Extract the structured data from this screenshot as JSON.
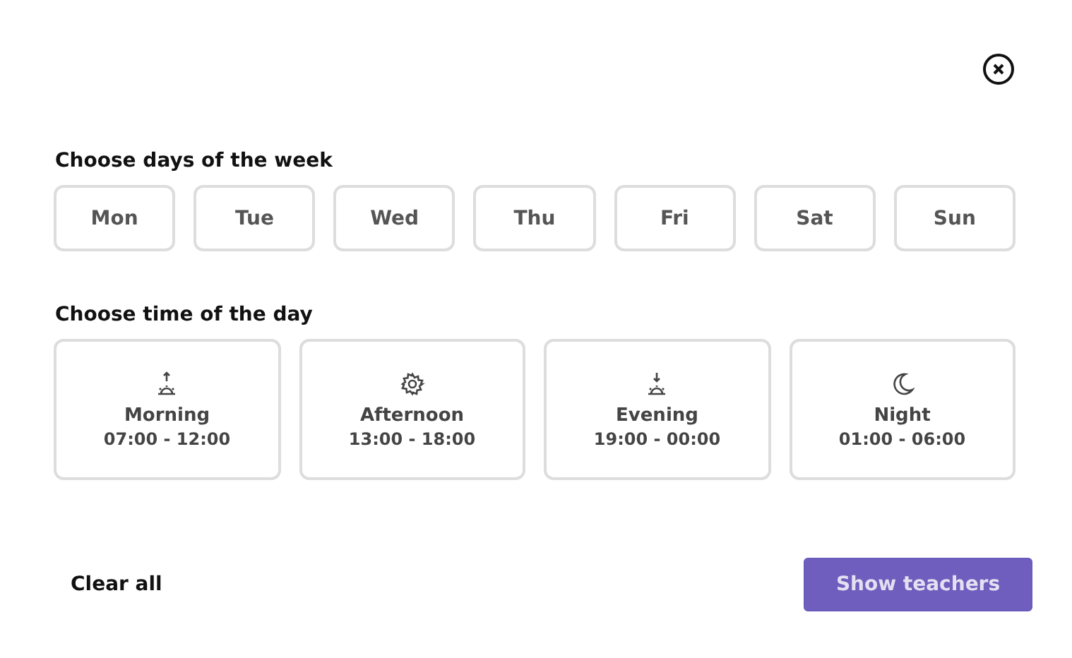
{
  "days_section": {
    "title": "Choose days of the week",
    "days": [
      {
        "label": "Mon",
        "selected": false
      },
      {
        "label": "Tue",
        "selected": false
      },
      {
        "label": "Wed",
        "selected": false
      },
      {
        "label": "Thu",
        "selected": false
      },
      {
        "label": "Fri",
        "selected": false
      },
      {
        "label": "Sat",
        "selected": false
      },
      {
        "label": "Sun",
        "selected": false
      }
    ]
  },
  "time_section": {
    "title": "Choose time of the day",
    "slots": [
      {
        "kind": "sunrise",
        "label": "Morning",
        "range": "07:00 - 12:00",
        "selected": false
      },
      {
        "kind": "sun",
        "label": "Afternoon",
        "range": "13:00 - 18:00",
        "selected": false
      },
      {
        "kind": "sunset",
        "label": "Evening",
        "range": "19:00 - 00:00",
        "selected": false
      },
      {
        "kind": "moon",
        "label": "Night",
        "range": "01:00 - 06:00",
        "selected": false
      }
    ]
  },
  "footer": {
    "clear": "Clear all",
    "submit": "Show teachers"
  }
}
